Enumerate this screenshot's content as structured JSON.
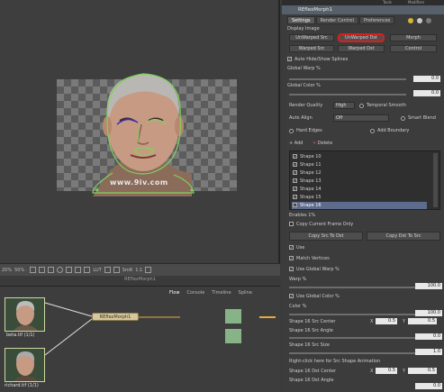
{
  "viewer": {
    "watermark": "www.9iv.com",
    "toolbar": {
      "zoom": "20%",
      "fit": "50% ·",
      "lut": "LUT",
      "smr": "SmR",
      "ratio": "1:1"
    },
    "label": "REflexMorph1"
  },
  "flow": {
    "tabs": [
      "Flow",
      "Console",
      "Timeline",
      "Spline"
    ],
    "node1_caption": "beta.tif (1/1)",
    "node2_caption": "richard.tif (1/1)",
    "morph_node": "REflexMorph1"
  },
  "panel": {
    "top_strip": [
      "Tools",
      "Modifiers"
    ],
    "title": "REflexMorph1",
    "tabs": [
      "Settings",
      "Render Control",
      "Preferences"
    ],
    "display_image_label": "Display Image",
    "display_buttons": [
      "UnWarped Src",
      "UnWarped Dst",
      "Morph",
      "Warped Src",
      "Warped Dst",
      "Control"
    ],
    "auto_hide": "Auto Hide/Show Splines",
    "global_warp_label": "Global Warp %",
    "global_warp_value": "0.0",
    "global_color_label": "Global Color %",
    "global_color_value": "0.0",
    "render_quality_label": "Render Quality",
    "render_quality_value": "High",
    "temporal_smooth": "Temporal Smooth",
    "auto_align_label": "Auto Align",
    "auto_align_value": "Off",
    "smart_blend": "Smart Blend",
    "hard_edges": "Hard Edges",
    "add_boundary": "Add Boundary",
    "add_label": "Add",
    "delete_label": "Delete",
    "shapes": [
      "Shape 10",
      "Shape 11",
      "Shape 12",
      "Shape 13",
      "Shape 14",
      "Shape 15",
      "Shape 16"
    ],
    "selected_shape": "Shape 16",
    "enables_label": "Enables 1%",
    "copy_current": "Copy Current Frame Only",
    "copy_src_to_dst": "Copy Src To Dst",
    "copy_dst_to_src": "Copy Dst To Src",
    "use": "Use",
    "match_vertices": "Match Vertices",
    "use_global_warp": "Use Global Warp %",
    "warp_label": "Warp %",
    "warp_value": "100.0",
    "use_global_color": "Use Global Color %",
    "color_label": "Color %",
    "color_value": "100.0",
    "src_center_label": "Shape 16 Src Center",
    "src_center_x": "0.5",
    "src_center_y": "0.5",
    "src_angle_label": "Shape 16 Src Angle",
    "src_angle_value": "0.0",
    "src_size_label": "Shape 16 Src Size",
    "src_size_value": "1.0",
    "right_click": "Right-click here for Src Shape Animation",
    "dst_center_label": "Shape 16 Dst Center",
    "dst_center_x": "0.5",
    "dst_center_y": "0.5",
    "dst_angle_label": "Shape 16 Dst Angle",
    "dst_angle_value": "0.0"
  },
  "colors": {
    "accent_red": "#d52020",
    "spline_green": "#7fd35a",
    "node_orange": "#e8a93a"
  }
}
